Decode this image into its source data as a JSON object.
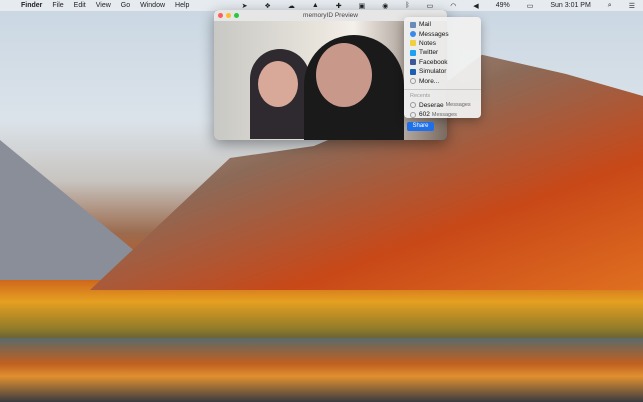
{
  "menubar": {
    "apple": "",
    "app": "Finder",
    "items": [
      "File",
      "Edit",
      "View",
      "Go",
      "Window",
      "Help"
    ],
    "battery": "49%",
    "clock": "Sun 3:01 PM"
  },
  "window": {
    "title": "memoryID Preview"
  },
  "share_menu": {
    "items": [
      {
        "label": "Mail",
        "color": "#6a8ab8"
      },
      {
        "label": "Messages",
        "color": "#3a8ae8"
      },
      {
        "label": "Notes",
        "color": "#f0d040"
      },
      {
        "label": "Twitter",
        "color": "#1da1f2"
      },
      {
        "label": "Facebook",
        "color": "#3b5998"
      },
      {
        "label": "Simulator",
        "color": "#1a5fb0"
      },
      {
        "label": "More...",
        "color": "#bbbbbb"
      }
    ],
    "recents_header": "Recents",
    "recents": [
      {
        "name": "Deserae",
        "app": "Messages"
      },
      {
        "name": "602",
        "app": "Messages"
      }
    ]
  },
  "share_button": "Share"
}
